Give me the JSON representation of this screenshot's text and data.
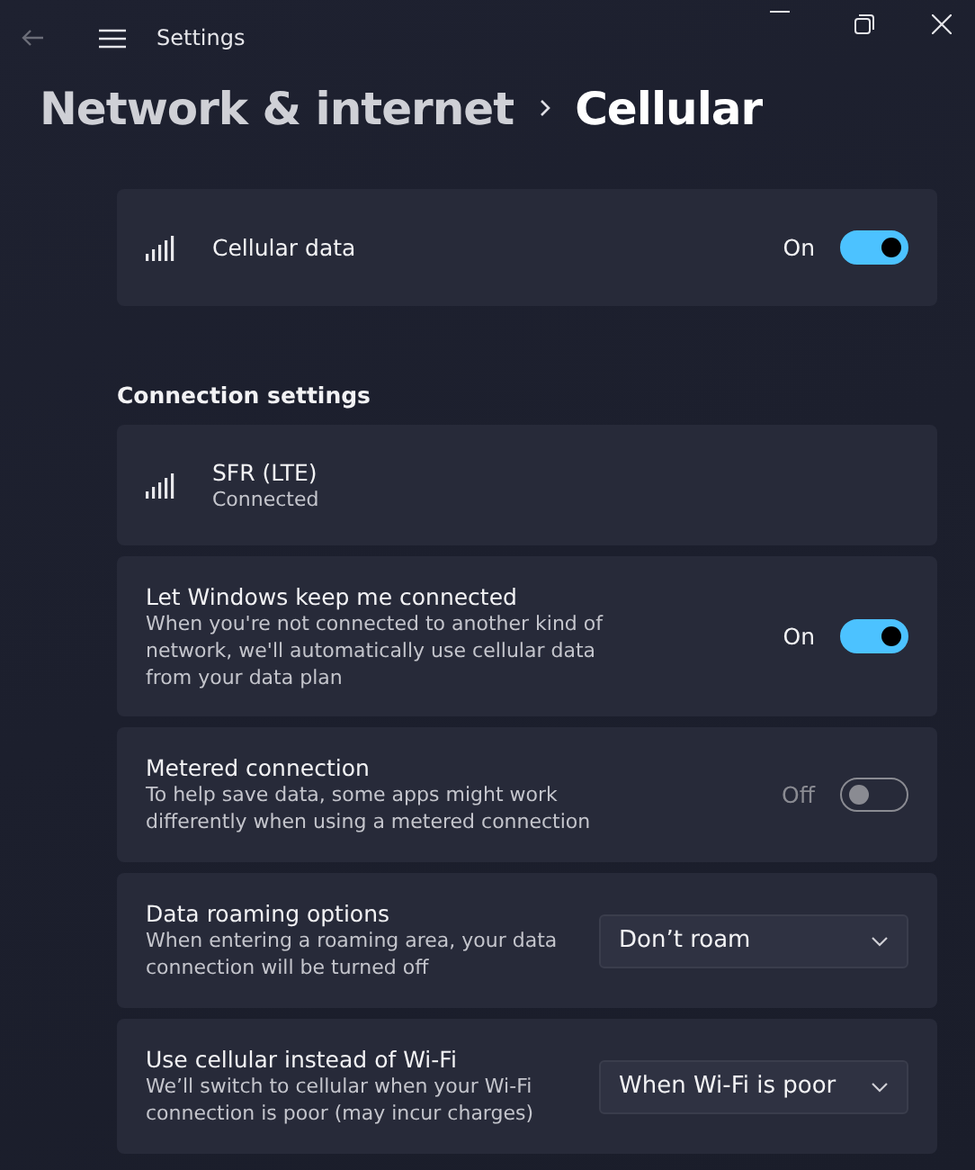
{
  "window": {
    "title": "Settings"
  },
  "breadcrumb": [
    {
      "label": "Network & internet",
      "current": false
    },
    {
      "label": "Cellular",
      "current": true
    }
  ],
  "top_card": {
    "title": "Cellular data",
    "state_label": "On",
    "on": true
  },
  "section": {
    "title": "Connection settings",
    "cards": [
      {
        "kind": "status",
        "title": "SFR (LTE)",
        "description": "Connected"
      },
      {
        "kind": "toggle",
        "title": "Let Windows keep me connected",
        "description": "When you're not connected to another kind of network, we'll automatically use cellular data from your data plan",
        "state_label": "On",
        "on": true
      },
      {
        "kind": "toggle",
        "title": "Metered connection",
        "description": "To help save data, some apps might work differently when using a metered connection",
        "state_label": "Off",
        "on": false
      },
      {
        "kind": "dropdown",
        "title": "Data roaming options",
        "description": "When entering a roaming area, your data connection will be turned off",
        "value": "Don’t roam"
      },
      {
        "kind": "dropdown",
        "title": "Use cellular instead of Wi-Fi",
        "description": "We’ll switch to cellular when your Wi-Fi connection is poor (may incur charges)",
        "value": "When Wi-Fi is poor"
      }
    ]
  }
}
